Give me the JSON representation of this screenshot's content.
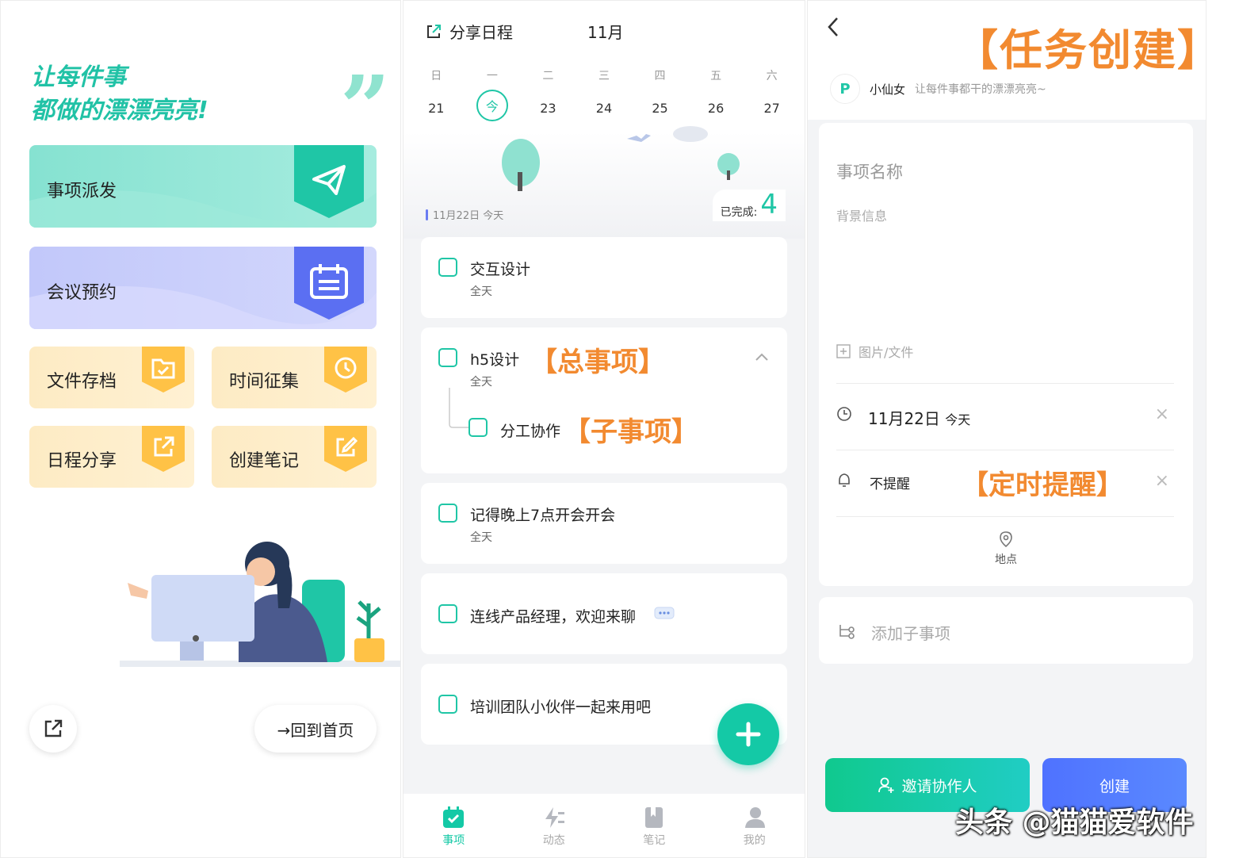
{
  "panel1": {
    "slogan_line1": "让每件事",
    "slogan_line2": "都做的漂漂亮亮!",
    "quote_mark": "”",
    "cards": [
      {
        "label": "事项派发",
        "icon": "paper-plane-icon"
      },
      {
        "label": "会议预约",
        "icon": "calendar-icon"
      }
    ],
    "small_cards": [
      {
        "label": "文件存档",
        "icon": "folder-check-icon"
      },
      {
        "label": "时间征集",
        "icon": "clock-icon"
      },
      {
        "label": "日程分享",
        "icon": "share-icon"
      },
      {
        "label": "创建笔记",
        "icon": "edit-icon"
      }
    ],
    "home_button": "→回到首页",
    "colors": {
      "mint": "#21c2a6",
      "lavender": "#c9cdfb",
      "amber": "#ffc246"
    }
  },
  "panel2": {
    "header_title": "分享日程",
    "month": "11月",
    "week": [
      {
        "wd": "日",
        "day": "21"
      },
      {
        "wd": "一",
        "day": "今"
      },
      {
        "wd": "二",
        "day": "23"
      },
      {
        "wd": "三",
        "day": "24"
      },
      {
        "wd": "四",
        "day": "25"
      },
      {
        "wd": "五",
        "day": "26"
      },
      {
        "wd": "六",
        "day": "27"
      }
    ],
    "today_label": "11月22日 今天",
    "done_label": "已完成:",
    "done_count": "4",
    "tasks": [
      {
        "title": "交互设计",
        "sub": "全天"
      },
      {
        "title": "h5设计",
        "sub": "全天",
        "annotation": "【总事项】",
        "child": "分工协作",
        "child_annotation": "【子事项】"
      },
      {
        "title": "记得晚上7点开会开会",
        "sub": "全天"
      },
      {
        "title": "连线产品经理，欢迎来聊",
        "sub": ""
      },
      {
        "title": "培训团队小伙伴一起来用吧",
        "sub": ""
      }
    ],
    "tabs": [
      {
        "label": "事项",
        "active": true
      },
      {
        "label": "动态",
        "active": false
      },
      {
        "label": "笔记",
        "active": false
      },
      {
        "label": "我的",
        "active": false
      }
    ],
    "accent": "#14c9a6"
  },
  "panel3": {
    "title": "【任务创建】",
    "avatar_text": "P",
    "user_name": "小仙女",
    "user_motto": "让每件事都干的漂漂亮亮~",
    "name_placeholder": "事项名称",
    "background_placeholder": "背景信息",
    "attach_label": "图片/文件",
    "date_label": "11月22日",
    "date_today": "今天",
    "reminder_label": "不提醒",
    "reminder_annotation": "【定时提醒】",
    "location_label": "地点",
    "add_subtask": "添加子事项",
    "invite_button": "邀请协作人",
    "create_button": "创建",
    "clear_glyph": "×"
  },
  "watermark": "头条 @猫猫爱软件"
}
